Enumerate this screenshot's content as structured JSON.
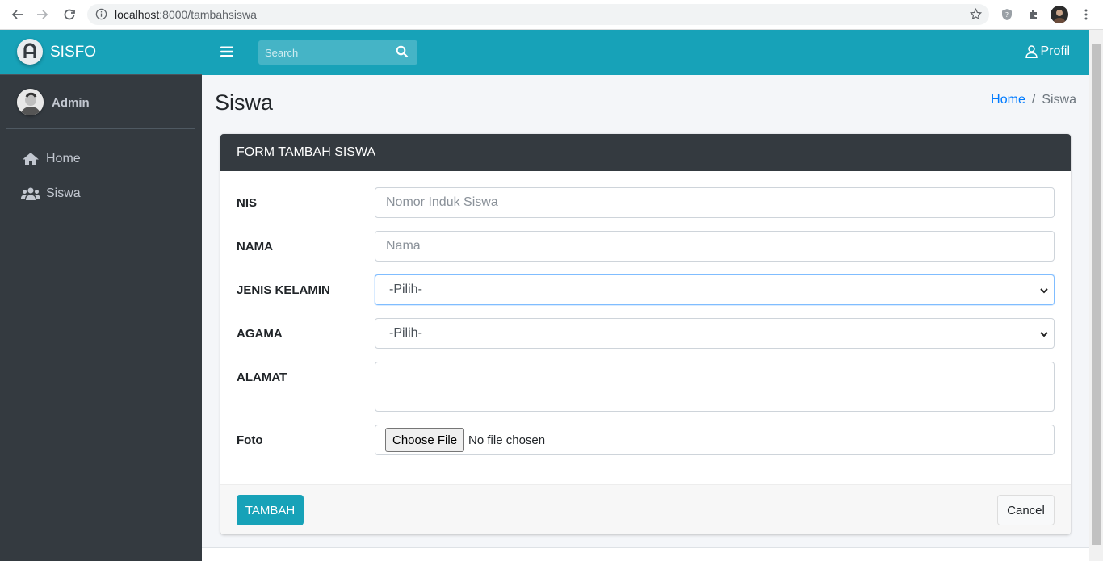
{
  "browser": {
    "url_host": "localhost",
    "url_path": ":8000/tambahsiswa",
    "icons": [
      "back-icon",
      "forward-icon",
      "reload-icon",
      "info-icon",
      "star-icon",
      "shield-icon",
      "puzzle-icon",
      "profile-avatar"
    ]
  },
  "sidebar": {
    "brand": "SISFO",
    "user": "Admin",
    "items": [
      {
        "label": "Home",
        "icon": "home-icon"
      },
      {
        "label": "Siswa",
        "icon": "users-icon"
      }
    ]
  },
  "topbar": {
    "search_placeholder": "Search",
    "profile_label": "Profil"
  },
  "content": {
    "title": "Siswa",
    "breadcrumb": {
      "home": "Home",
      "separator": "/",
      "current": "Siswa"
    }
  },
  "form": {
    "title": "FORM TAMBAH SISWA",
    "fields": {
      "nis": {
        "label": "NIS",
        "placeholder": "Nomor Induk Siswa"
      },
      "nama": {
        "label": "NAMA",
        "placeholder": "Nama"
      },
      "jenis_kelamin": {
        "label": "JENIS KELAMIN",
        "selected": "-Pilih-"
      },
      "agama": {
        "label": "AGAMA",
        "selected": "-Pilih-"
      },
      "alamat": {
        "label": "ALAMAT",
        "value": ""
      },
      "foto": {
        "label": "Foto",
        "button": "Choose File",
        "status": "No file chosen"
      }
    },
    "submit_label": "TAMBAH",
    "cancel_label": "Cancel"
  },
  "colors": {
    "primary": "#17a2b8",
    "sidebar": "#343a40",
    "link": "#007bff"
  }
}
